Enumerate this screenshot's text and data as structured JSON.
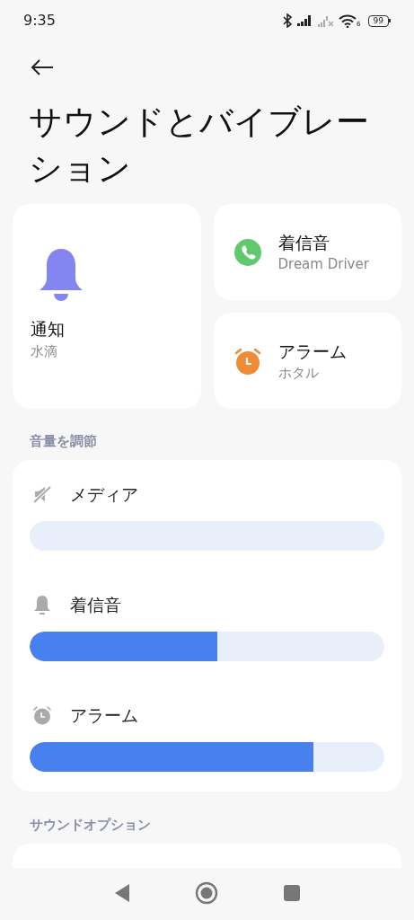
{
  "status_bar": {
    "time": "9:35",
    "wifi_badge": "6",
    "battery": "99"
  },
  "title": "サウンドとバイブレーション",
  "shortcuts": [
    {
      "kind": "notification",
      "label": "通知",
      "value": "水滴"
    },
    {
      "kind": "ringtone",
      "label": "着信音",
      "value": "Dream Driver"
    },
    {
      "kind": "alarm",
      "label": "アラーム",
      "value": "ホタル"
    }
  ],
  "volume_section": {
    "header": "音量を調節",
    "sliders": [
      {
        "kind": "muted",
        "label": "メディア",
        "level": 0
      },
      {
        "kind": "bell",
        "label": "着信音",
        "level": 0.53
      },
      {
        "kind": "alarm",
        "label": "アラーム",
        "level": 0.8
      }
    ]
  },
  "options_section": {
    "header": "サウンドオプション"
  }
}
